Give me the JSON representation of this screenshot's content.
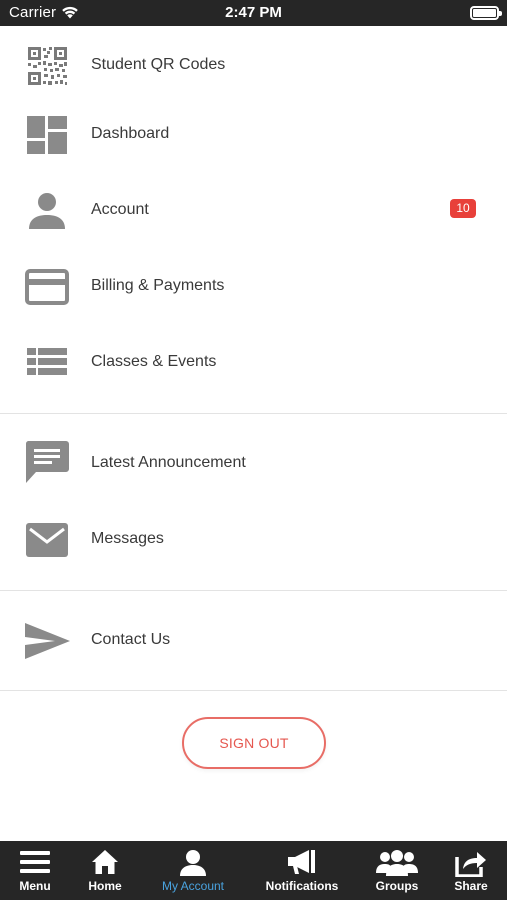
{
  "status_bar": {
    "carrier": "Carrier",
    "time": "2:47 PM"
  },
  "menu": {
    "items": [
      {
        "label": "Student QR Codes",
        "icon": "qr-code-icon"
      },
      {
        "label": "Dashboard",
        "icon": "dashboard-icon"
      },
      {
        "label": "Account",
        "icon": "person-icon",
        "badge": "10"
      },
      {
        "label": "Billing & Payments",
        "icon": "credit-card-icon"
      },
      {
        "label": "Classes & Events",
        "icon": "list-icon"
      },
      {
        "label": "Latest Announcement",
        "icon": "chat-bubble-icon"
      },
      {
        "label": "Messages",
        "icon": "envelope-icon"
      },
      {
        "label": "Contact Us",
        "icon": "send-icon"
      }
    ]
  },
  "sign_out": {
    "label": "SIGN OUT"
  },
  "tab_bar": {
    "tabs": [
      {
        "label": "Menu",
        "icon": "hamburger-icon"
      },
      {
        "label": "Home",
        "icon": "home-icon"
      },
      {
        "label": "My Account",
        "icon": "person-icon",
        "active": true
      },
      {
        "label": "Notifications",
        "icon": "megaphone-icon"
      },
      {
        "label": "Groups",
        "icon": "group-icon"
      },
      {
        "label": "Share",
        "icon": "share-icon"
      }
    ]
  },
  "colors": {
    "accent": "#4aa3df",
    "badge": "#e8403a",
    "sign_out": "#e5574f",
    "icon_gray": "#8a8a8a",
    "bar": "#262626"
  }
}
